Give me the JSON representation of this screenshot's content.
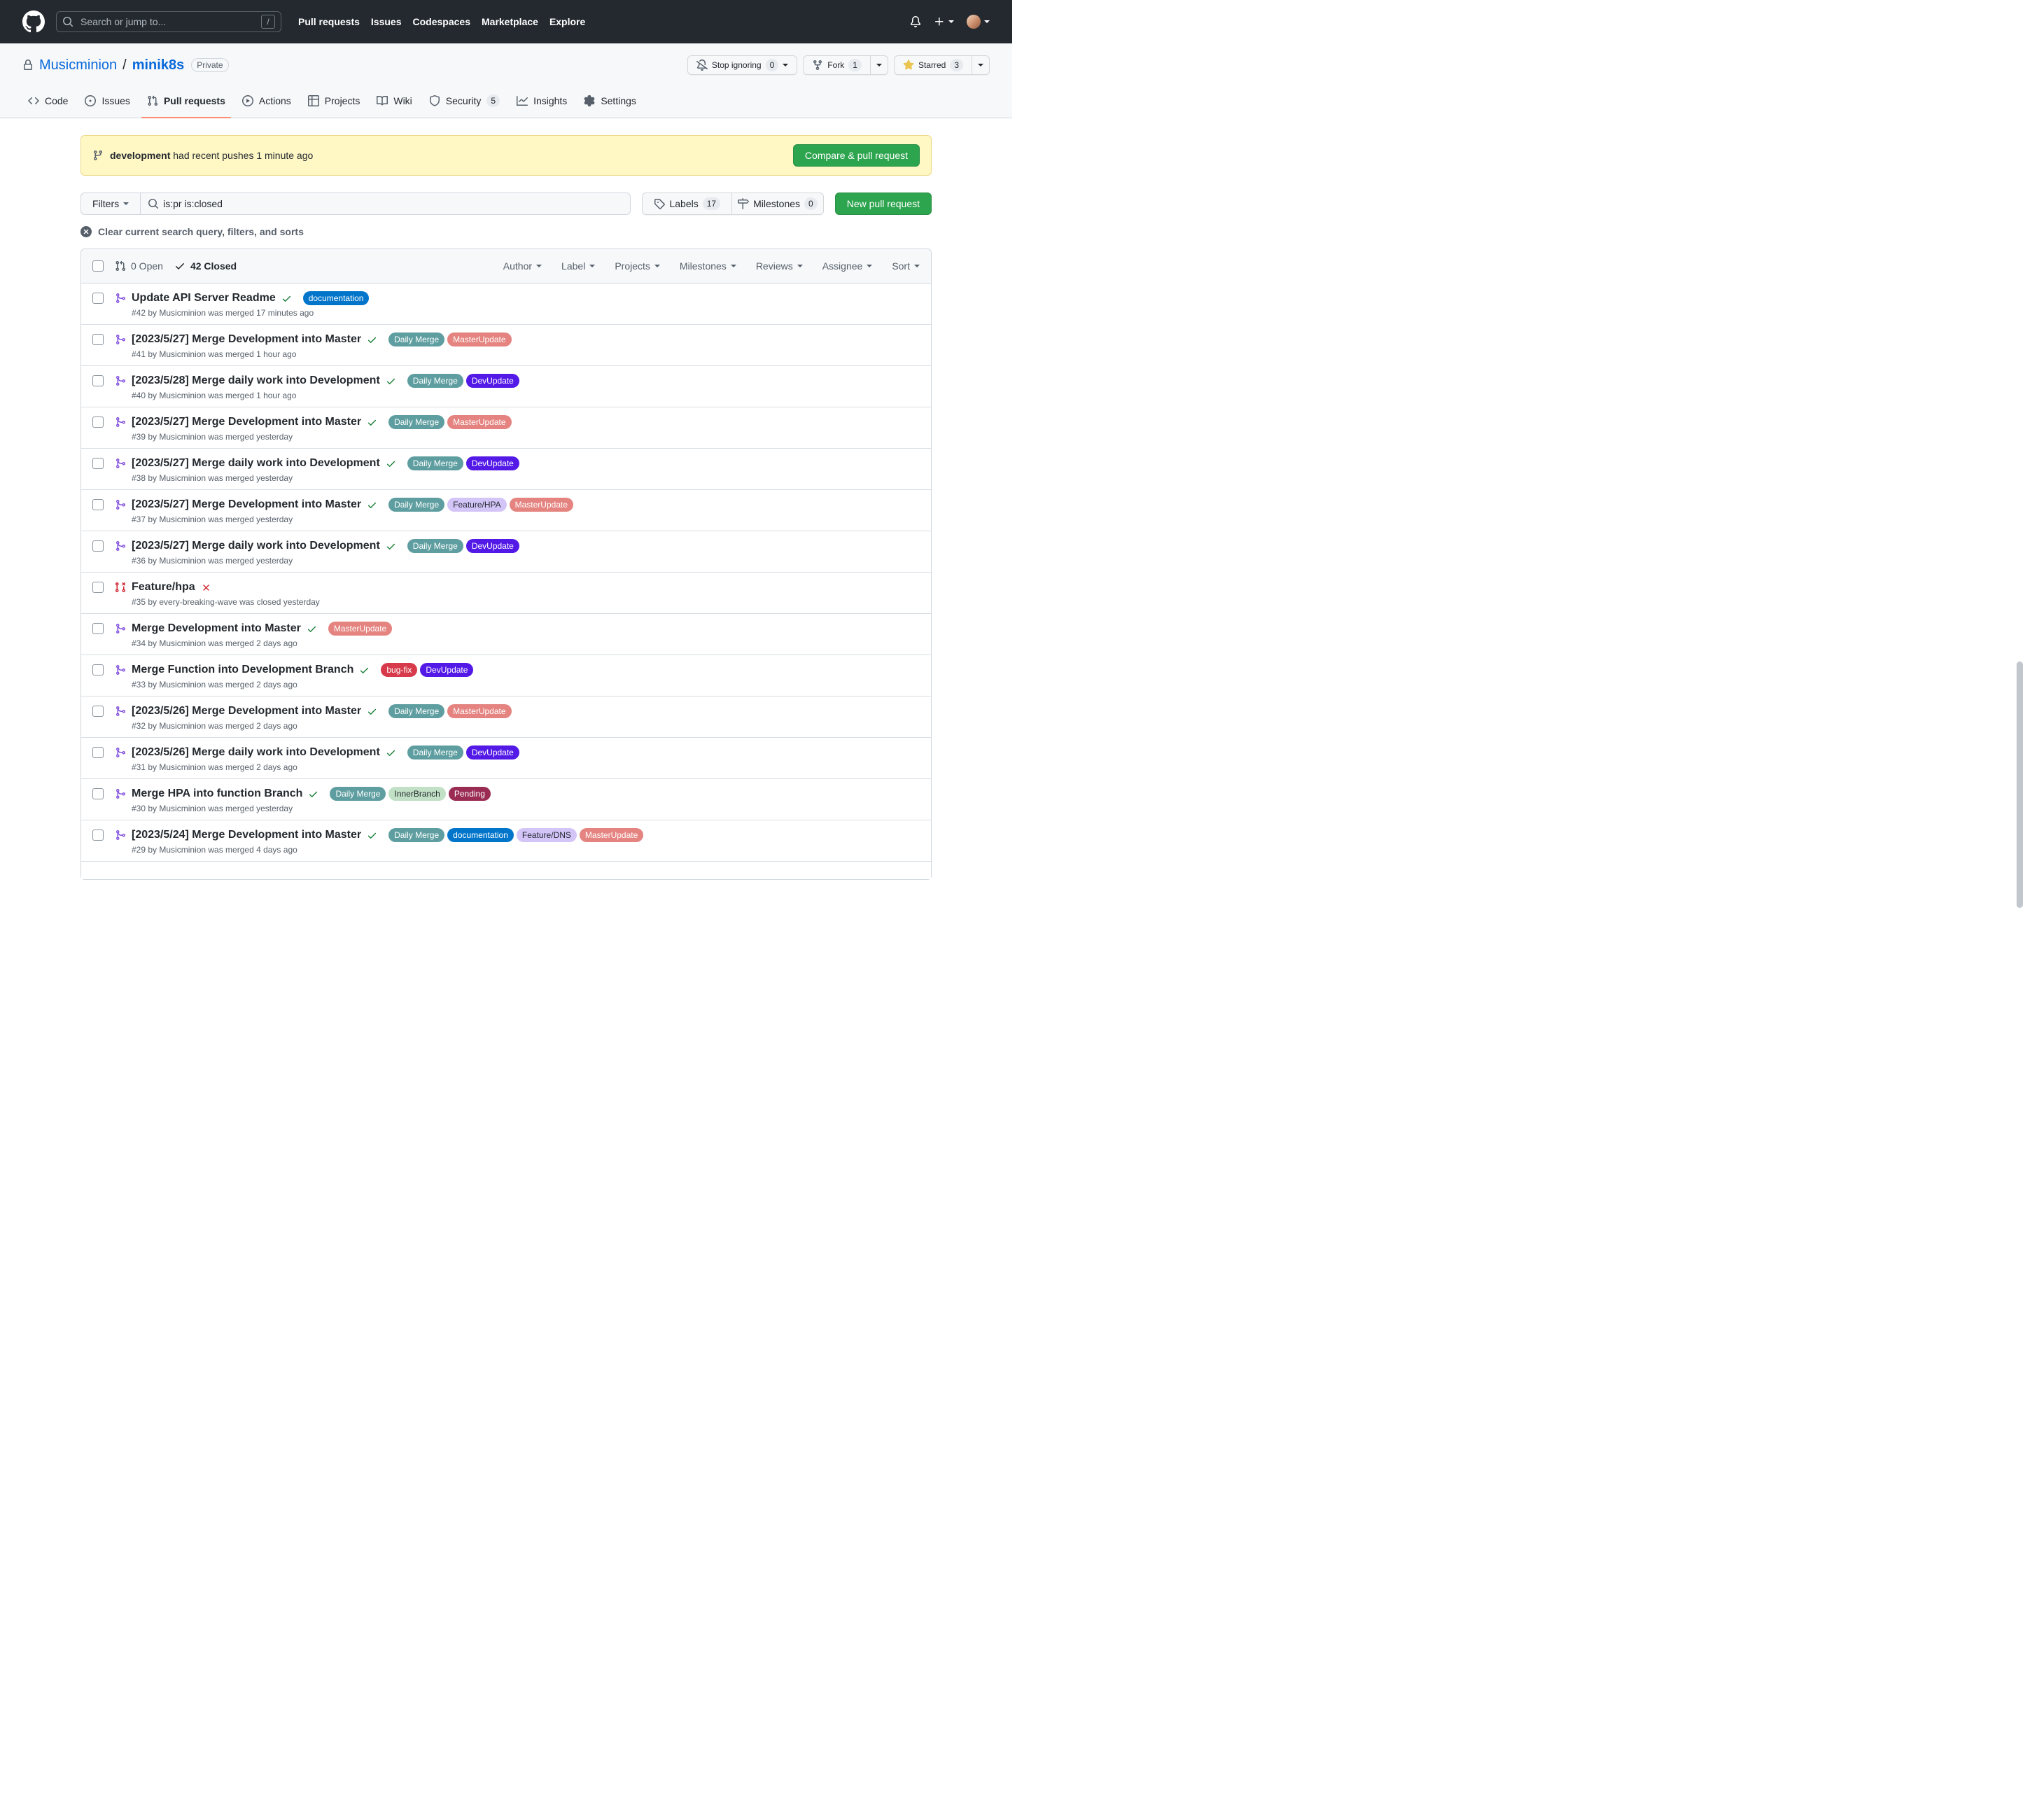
{
  "topnav": {
    "search": {
      "placeholder": "Search or jump to...",
      "key_hint": "/"
    },
    "links": [
      {
        "label": "Pull requests"
      },
      {
        "label": "Issues"
      },
      {
        "label": "Codespaces"
      },
      {
        "label": "Marketplace"
      },
      {
        "label": "Explore"
      }
    ]
  },
  "repo_header": {
    "owner": "Musicminion",
    "separator": "/",
    "name": "minik8s",
    "visibility_badge": "Private",
    "watch_button": {
      "label": "Stop ignoring",
      "count": "0"
    },
    "fork_button": {
      "label": "Fork",
      "count": "1"
    },
    "star_button": {
      "label": "Starred",
      "count": "3"
    }
  },
  "tabs": [
    {
      "label": "Code"
    },
    {
      "label": "Issues"
    },
    {
      "label": "Pull requests"
    },
    {
      "label": "Actions"
    },
    {
      "label": "Projects"
    },
    {
      "label": "Wiki"
    },
    {
      "label": "Security",
      "count": "5"
    },
    {
      "label": "Insights"
    },
    {
      "label": "Settings"
    }
  ],
  "notice_banner": {
    "branch": "development",
    "message": "had recent pushes 1 minute ago",
    "cta": "Compare & pull request"
  },
  "filter_bar": {
    "filters_button": "Filters",
    "search_value": "is:pr is:closed",
    "labels_button": {
      "label": "Labels",
      "count": "17"
    },
    "milestones_button": {
      "label": "Milestones",
      "count": "0"
    },
    "new_pr_button": "New pull request",
    "clear_link": "Clear current search query, filters, and sorts"
  },
  "pr_list": {
    "open_tab": "0 Open",
    "closed_tab": "42 Closed",
    "header_filters": [
      "Author",
      "Label",
      "Projects",
      "Milestones",
      "Reviews",
      "Assignee",
      "Sort"
    ]
  },
  "label_styles": {
    "documentation": {
      "bg": "#0075ca",
      "fg": "#ffffff"
    },
    "Daily Merge": {
      "bg": "#5f9ea0",
      "fg": "#ffffff"
    },
    "MasterUpdate": {
      "bg": "#e4837f",
      "fg": "#ffffff"
    },
    "DevUpdate": {
      "bg": "#5319e7",
      "fg": "#ffffff"
    },
    "Feature/HPA": {
      "bg": "#d4c5f9",
      "fg": "#24292f"
    },
    "bug-fix": {
      "bg": "#d73a4a",
      "fg": "#ffffff"
    },
    "InnerBranch": {
      "bg": "#c2e0c6",
      "fg": "#24292f"
    },
    "Pending": {
      "bg": "#9a2c54",
      "fg": "#ffffff"
    },
    "Feature/DNS": {
      "bg": "#d4c5f9",
      "fg": "#24292f"
    }
  },
  "pull_requests": [
    {
      "title": "Update API Server Readme",
      "state": "merged",
      "check": "pass",
      "labels": [
        "documentation"
      ],
      "meta": "#42 by Musicminion was merged 17 minutes ago"
    },
    {
      "title": "[2023/5/27] Merge Development into Master",
      "state": "merged",
      "check": "pass",
      "labels": [
        "Daily Merge",
        "MasterUpdate"
      ],
      "meta": "#41 by Musicminion was merged 1 hour ago"
    },
    {
      "title": "[2023/5/28] Merge daily work into Development",
      "state": "merged",
      "check": "pass",
      "labels": [
        "Daily Merge",
        "DevUpdate"
      ],
      "meta": "#40 by Musicminion was merged 1 hour ago"
    },
    {
      "title": "[2023/5/27] Merge Development into Master",
      "state": "merged",
      "check": "pass",
      "labels": [
        "Daily Merge",
        "MasterUpdate"
      ],
      "meta": "#39 by Musicminion was merged yesterday"
    },
    {
      "title": "[2023/5/27] Merge daily work into Development",
      "state": "merged",
      "check": "pass",
      "labels": [
        "Daily Merge",
        "DevUpdate"
      ],
      "meta": "#38 by Musicminion was merged yesterday"
    },
    {
      "title": "[2023/5/27] Merge Development into Master",
      "state": "merged",
      "check": "pass",
      "labels": [
        "Daily Merge",
        "Feature/HPA",
        "MasterUpdate"
      ],
      "meta": "#37 by Musicminion was merged yesterday"
    },
    {
      "title": "[2023/5/27] Merge daily work into Development",
      "state": "merged",
      "check": "pass",
      "labels": [
        "Daily Merge",
        "DevUpdate"
      ],
      "meta": "#36 by Musicminion was merged yesterday"
    },
    {
      "title": "Feature/hpa",
      "state": "closed",
      "check": "fail",
      "labels": [],
      "meta": "#35 by every-breaking-wave was closed yesterday"
    },
    {
      "title": "Merge Development into Master",
      "state": "merged",
      "check": "pass",
      "labels": [
        "MasterUpdate"
      ],
      "meta": "#34 by Musicminion was merged 2 days ago"
    },
    {
      "title": "Merge Function into Development Branch",
      "state": "merged",
      "check": "pass",
      "labels": [
        "bug-fix",
        "DevUpdate"
      ],
      "meta": "#33 by Musicminion was merged 2 days ago"
    },
    {
      "title": "[2023/5/26] Merge Development into Master",
      "state": "merged",
      "check": "pass",
      "labels": [
        "Daily Merge",
        "MasterUpdate"
      ],
      "meta": "#32 by Musicminion was merged 2 days ago"
    },
    {
      "title": "[2023/5/26] Merge daily work into Development",
      "state": "merged",
      "check": "pass",
      "labels": [
        "Daily Merge",
        "DevUpdate"
      ],
      "meta": "#31 by Musicminion was merged 2 days ago"
    },
    {
      "title": "Merge HPA into function Branch",
      "state": "merged",
      "check": "pass",
      "labels": [
        "Daily Merge",
        "InnerBranch",
        "Pending"
      ],
      "meta": "#30 by Musicminion was merged yesterday"
    },
    {
      "title": "[2023/5/24] Merge Development into Master",
      "state": "merged",
      "check": "pass",
      "labels": [
        "Daily Merge",
        "documentation",
        "Feature/DNS",
        "MasterUpdate"
      ],
      "meta": "#29 by Musicminion was merged 4 days ago"
    }
  ]
}
